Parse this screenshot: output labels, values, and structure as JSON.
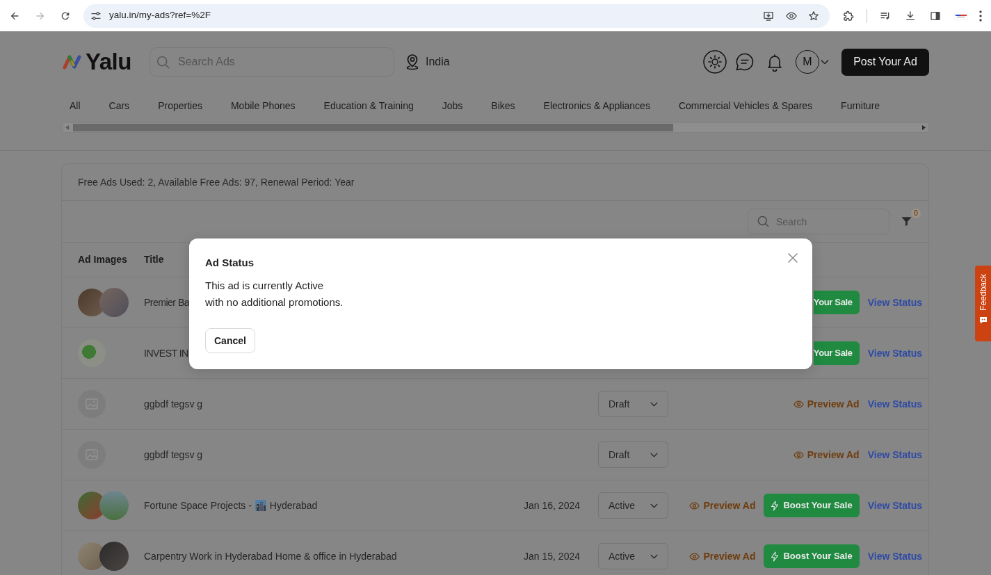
{
  "browser": {
    "url": "yalu.in/my-ads?ref=%2F",
    "back_disabled": false,
    "forward_disabled": true
  },
  "header": {
    "logo": "Yalu",
    "search_placeholder": "Search Ads",
    "location": "India",
    "avatar": "M",
    "post_button": "Post Your Ad"
  },
  "categories": [
    "All",
    "Cars",
    "Properties",
    "Mobile Phones",
    "Education & Training",
    "Jobs",
    "Bikes",
    "Electronics & Appliances",
    "Commercial Vehicles & Spares",
    "Furniture"
  ],
  "summary": "Free Ads Used: 2, Available Free Ads: 97, Renewal Period: Year",
  "toolbar": {
    "search_placeholder": "Search",
    "filter_count": "0"
  },
  "table": {
    "columns": [
      "Ad Images",
      "Title"
    ],
    "rows": [
      {
        "kind": "two-photos",
        "partly_hidden": true,
        "title": "Premier Ba",
        "boost": "Your Sale",
        "view": "View Status"
      },
      {
        "kind": "one-photo",
        "partly_hidden": true,
        "title": "INVEST IN",
        "boost": "Your Sale",
        "view": "View Status"
      },
      {
        "kind": "no-photo",
        "partly_hidden": false,
        "title": "ggbdf tegsv g",
        "status": "Draft",
        "preview": "Preview Ad",
        "view": "View Status"
      },
      {
        "kind": "no-photo",
        "partly_hidden": false,
        "title": "ggbdf tegsv g",
        "status": "Draft",
        "preview": "Preview Ad",
        "view": "View Status"
      },
      {
        "kind": "two-photos",
        "partly_hidden": false,
        "title": "Fortune Space Projects -",
        "location": "Hyderabad",
        "date": "Jan 16, 2024",
        "status": "Active",
        "preview": "Preview Ad",
        "boost": "Boost Your Sale",
        "view": "View Status"
      },
      {
        "kind": "two-photos",
        "partly_hidden": false,
        "title": "Carpentry Work in Hyderabad Home & office in Hyderabad",
        "date": "Jan 15, 2024",
        "status": "Active",
        "preview": "Preview Ad",
        "boost": "Boost Your Sale",
        "view": "View Status"
      }
    ]
  },
  "modal": {
    "title": "Ad Status",
    "message": [
      "This ad is currently Active",
      "with no additional promotions."
    ],
    "cancel": "Cancel"
  },
  "feedback": "Feedback"
}
